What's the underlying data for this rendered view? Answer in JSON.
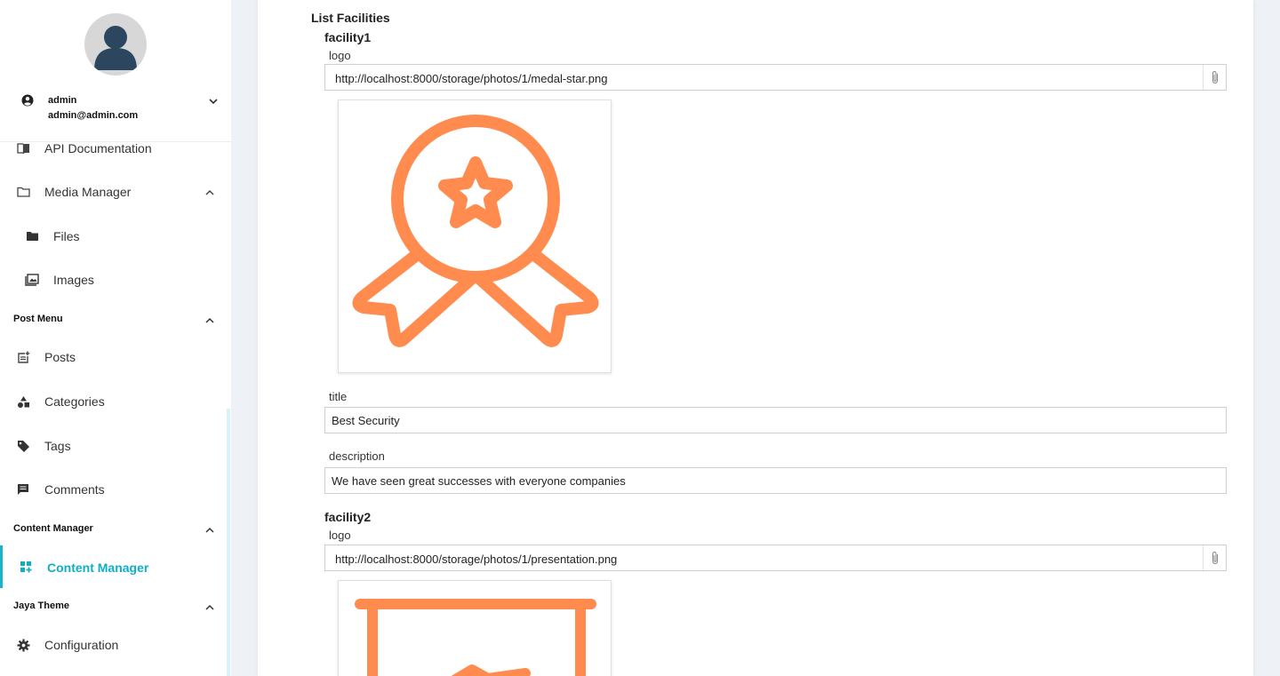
{
  "user": {
    "name": "admin",
    "email": "admin@admin.com"
  },
  "sidebar": {
    "items": [
      {
        "label": "API Documentation",
        "icon": "book-icon"
      },
      {
        "label": "Media Manager",
        "icon": "folder-outline-icon"
      },
      {
        "label": "Files",
        "icon": "folder-icon"
      },
      {
        "label": "Images",
        "icon": "images-icon"
      },
      {
        "label": "Posts",
        "icon": "post-add-icon"
      },
      {
        "label": "Categories",
        "icon": "category-shapes-icon"
      },
      {
        "label": "Tags",
        "icon": "tag-icon"
      },
      {
        "label": "Comments",
        "icon": "comment-icon"
      },
      {
        "label": "Content Manager",
        "icon": "dashboard-plus-icon"
      },
      {
        "label": "Configuration",
        "icon": "gear-icon"
      }
    ],
    "sections": [
      {
        "label": "Post Menu"
      },
      {
        "label": "Content Manager"
      },
      {
        "label": "Jaya Theme"
      }
    ]
  },
  "content": {
    "title": "List Facilities",
    "facilities": [
      {
        "heading": "facility1",
        "logo_label": "logo",
        "logo_url": "http://localhost:8000/storage/photos/1/medal-star.png",
        "title_label": "title",
        "title_value": "Best Security",
        "description_label": "description",
        "description_value": "We have seen great successes with everyone companies"
      },
      {
        "heading": "facility2",
        "logo_label": "logo",
        "logo_url": "http://localhost:8000/storage/photos/1/presentation.png"
      }
    ]
  },
  "colors": {
    "accent": "#10aec6",
    "logo_orange": "#ff8c4e"
  }
}
